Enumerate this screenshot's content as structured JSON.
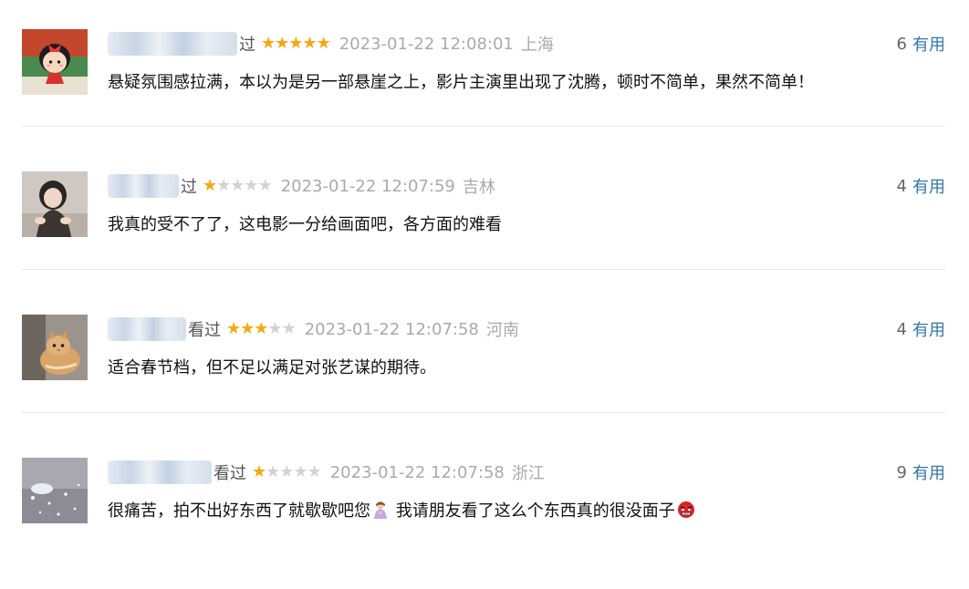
{
  "comments": [
    {
      "watched": "过",
      "rating": 5,
      "time": "2023-01-22 12:08:01",
      "location": "上海",
      "useful_count": "6",
      "useful_label": "有用",
      "text": "悬疑氛围感拉满，本以为是另一部悬崖之上，影片主演里出现了沈腾，顿时不简单，果然不简单！",
      "avatar_icon": "cartoon-girl-avatar-icon"
    },
    {
      "watched": "过",
      "rating": 1,
      "time": "2023-01-22 12:07:59",
      "location": "吉林",
      "useful_count": "4",
      "useful_label": "有用",
      "text": "我真的受不了了，这电影一分给画面吧，各方面的难看",
      "avatar_icon": "girl-photo-avatar-icon"
    },
    {
      "watched": "看过",
      "rating": 3,
      "time": "2023-01-22 12:07:58",
      "location": "河南",
      "useful_count": "4",
      "useful_label": "有用",
      "text": "适合春节档，但不足以满足对张艺谋的期待。",
      "avatar_icon": "cat-photo-avatar-icon"
    },
    {
      "watched": "看过",
      "rating": 1,
      "time": "2023-01-22 12:07:58",
      "location": "浙江",
      "useful_count": "9",
      "useful_label": "有用",
      "text_part1": "很痛苦，拍不出好东西了就歇歇吧您",
      "text_part2": "我请朋友看了这么个东西真的很没面子",
      "avatar_icon": "sparkle-photo-avatar-icon",
      "emojis": [
        "person-bowing-emoji-icon",
        "angry-face-emoji-icon"
      ]
    }
  ],
  "colors": {
    "star_on": "#f4a90f",
    "star_off": "#d3d3d3",
    "useful_link": "#3377aa",
    "meta_text": "#aaaaaa"
  }
}
